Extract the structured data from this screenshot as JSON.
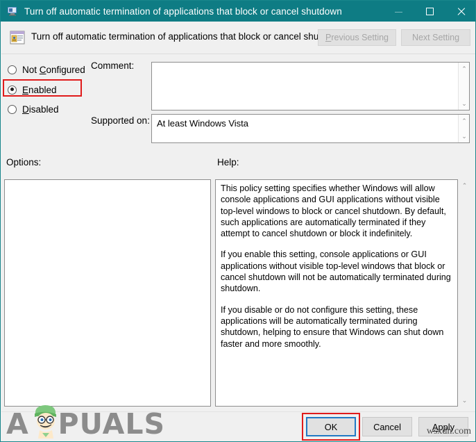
{
  "window": {
    "title": "Turn off automatic termination of applications that block or cancel shutdown",
    "icon": "policy-monitor-icon",
    "minimize_label": "minimize-icon",
    "maximize_label": "maximize-icon",
    "close_label": "close-icon",
    "titlebar_color": "#0e7c84",
    "border_color": "#18868c"
  },
  "header": {
    "icon": "policy-setting-icon",
    "title": "Turn off automatic termination of applications that block or cancel shutdown",
    "previous_setting": "Previous Setting",
    "previous_accesskey": "P",
    "next_setting": "Next Setting",
    "next_accesskey": "N"
  },
  "state": {
    "options": [
      {
        "label": "Not Configured",
        "accesskey": "C",
        "selected": false
      },
      {
        "label": "Enabled",
        "accesskey": "E",
        "selected": true
      },
      {
        "label": "Disabled",
        "accesskey": "D",
        "selected": false
      }
    ],
    "highlight_color": "#e01b1b"
  },
  "fields": {
    "comment_label": "Comment:",
    "comment_value": "",
    "supported_label": "Supported on:",
    "supported_value": "At least Windows Vista"
  },
  "panels": {
    "options_label": "Options:",
    "options_content": "",
    "help_label": "Help:",
    "help_paragraphs": [
      "This policy setting specifies whether Windows will allow console applications and GUI applications without visible top-level windows to block or cancel shutdown. By default, such applications are automatically terminated if they attempt to cancel shutdown or block it indefinitely.",
      "If you enable this setting, console applications or GUI applications without visible top-level windows that block or cancel shutdown will not be automatically terminated during shutdown.",
      "If you disable or do not configure this setting, these applications will be automatically terminated during shutdown, helping to ensure that Windows can shut down faster and more smoothly."
    ]
  },
  "footer": {
    "ok": "OK",
    "cancel": "Cancel",
    "apply": "Apply",
    "apply_accesskey": "A",
    "ok_focus_color": "#2279c4",
    "ok_highlight_color": "#e01b1b"
  },
  "watermarks": {
    "brand_prefix": "A",
    "brand_suffix": "PUALS",
    "site": "wsxdn.com"
  },
  "scrollbar": {
    "up_glyph": "⌃",
    "down_glyph": "⌄"
  }
}
